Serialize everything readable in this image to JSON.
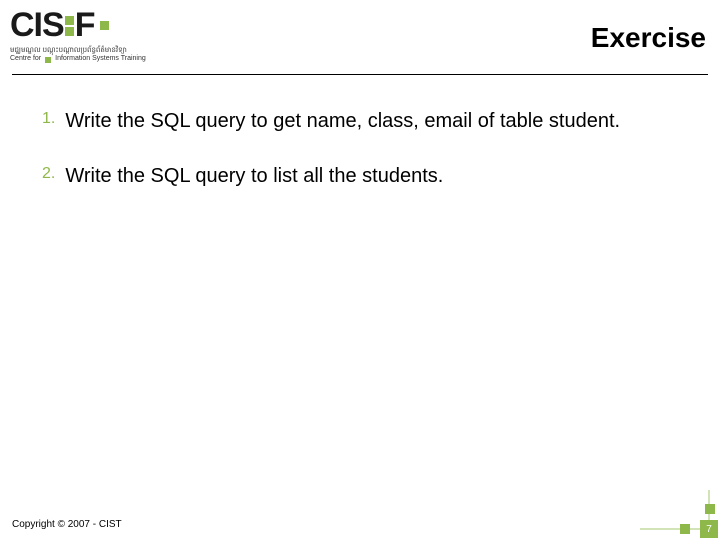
{
  "header": {
    "logo_left": "CIS",
    "logo_right": "F",
    "tagline_line1": "មជ្ឈមណ្ឌល បណ្តុះបណ្តាលប្រព័ន្ធព័ត៌មានវិទ្យា",
    "tagline_left": "Centre for",
    "tagline_right": "Information Systems Training",
    "title": "Exercise"
  },
  "items": [
    {
      "num": "1.",
      "text": "Write the SQL query to get name, class, email of table student."
    },
    {
      "num": "2.",
      "text": "Write the SQL query to list all the students."
    }
  ],
  "footer": {
    "copyright": "Copyright © 2007 - CIST",
    "page": "7"
  }
}
